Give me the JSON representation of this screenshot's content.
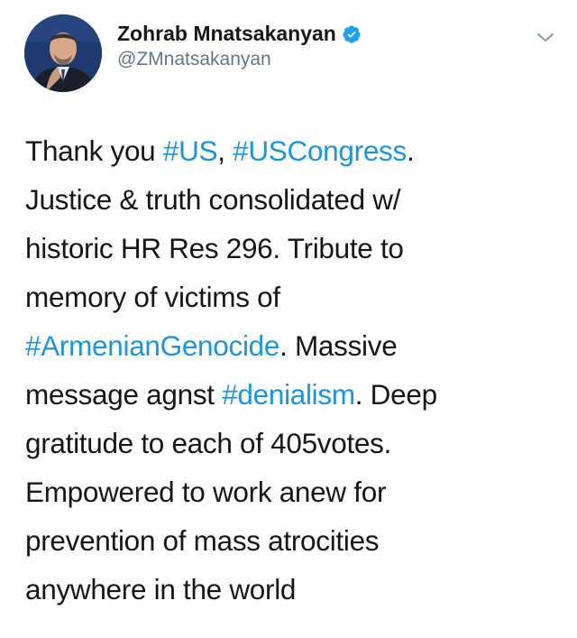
{
  "author": {
    "display_name": "Zohrab Mnatsakanyan",
    "handle": "@ZMnatsakanyan",
    "verified_icon": "verified-badge-icon",
    "avatar_icon": "profile-photo"
  },
  "menu": {
    "icon": "chevron-down-icon"
  },
  "colors": {
    "link": "#1b95e0",
    "verified": "#1da1f2",
    "text": "#14171a",
    "secondary": "#657786"
  },
  "tweet": {
    "lines": [
      [
        {
          "t": "Thank you "
        },
        {
          "t": "#US",
          "tag": true
        },
        {
          "t": ", "
        },
        {
          "t": "#USCongress",
          "tag": true
        },
        {
          "t": "."
        }
      ],
      [
        {
          "t": "Justice & truth consolidated w/"
        }
      ],
      [
        {
          "t": "historic HR Res 296. Tribute to"
        }
      ],
      [
        {
          "t": "memory of victims of"
        }
      ],
      [
        {
          "t": "#ArmenianGenocide",
          "tag": true
        },
        {
          "t": ". Massive"
        }
      ],
      [
        {
          "t": "message agnst "
        },
        {
          "t": "#denialism",
          "tag": true
        },
        {
          "t": ". Deep"
        }
      ],
      [
        {
          "t": "gratitude to each of 405votes."
        }
      ],
      [
        {
          "t": "Empowered to work anew for"
        }
      ],
      [
        {
          "t": "prevention of mass atrocities"
        }
      ],
      [
        {
          "t": "anywhere in the world"
        }
      ]
    ]
  }
}
